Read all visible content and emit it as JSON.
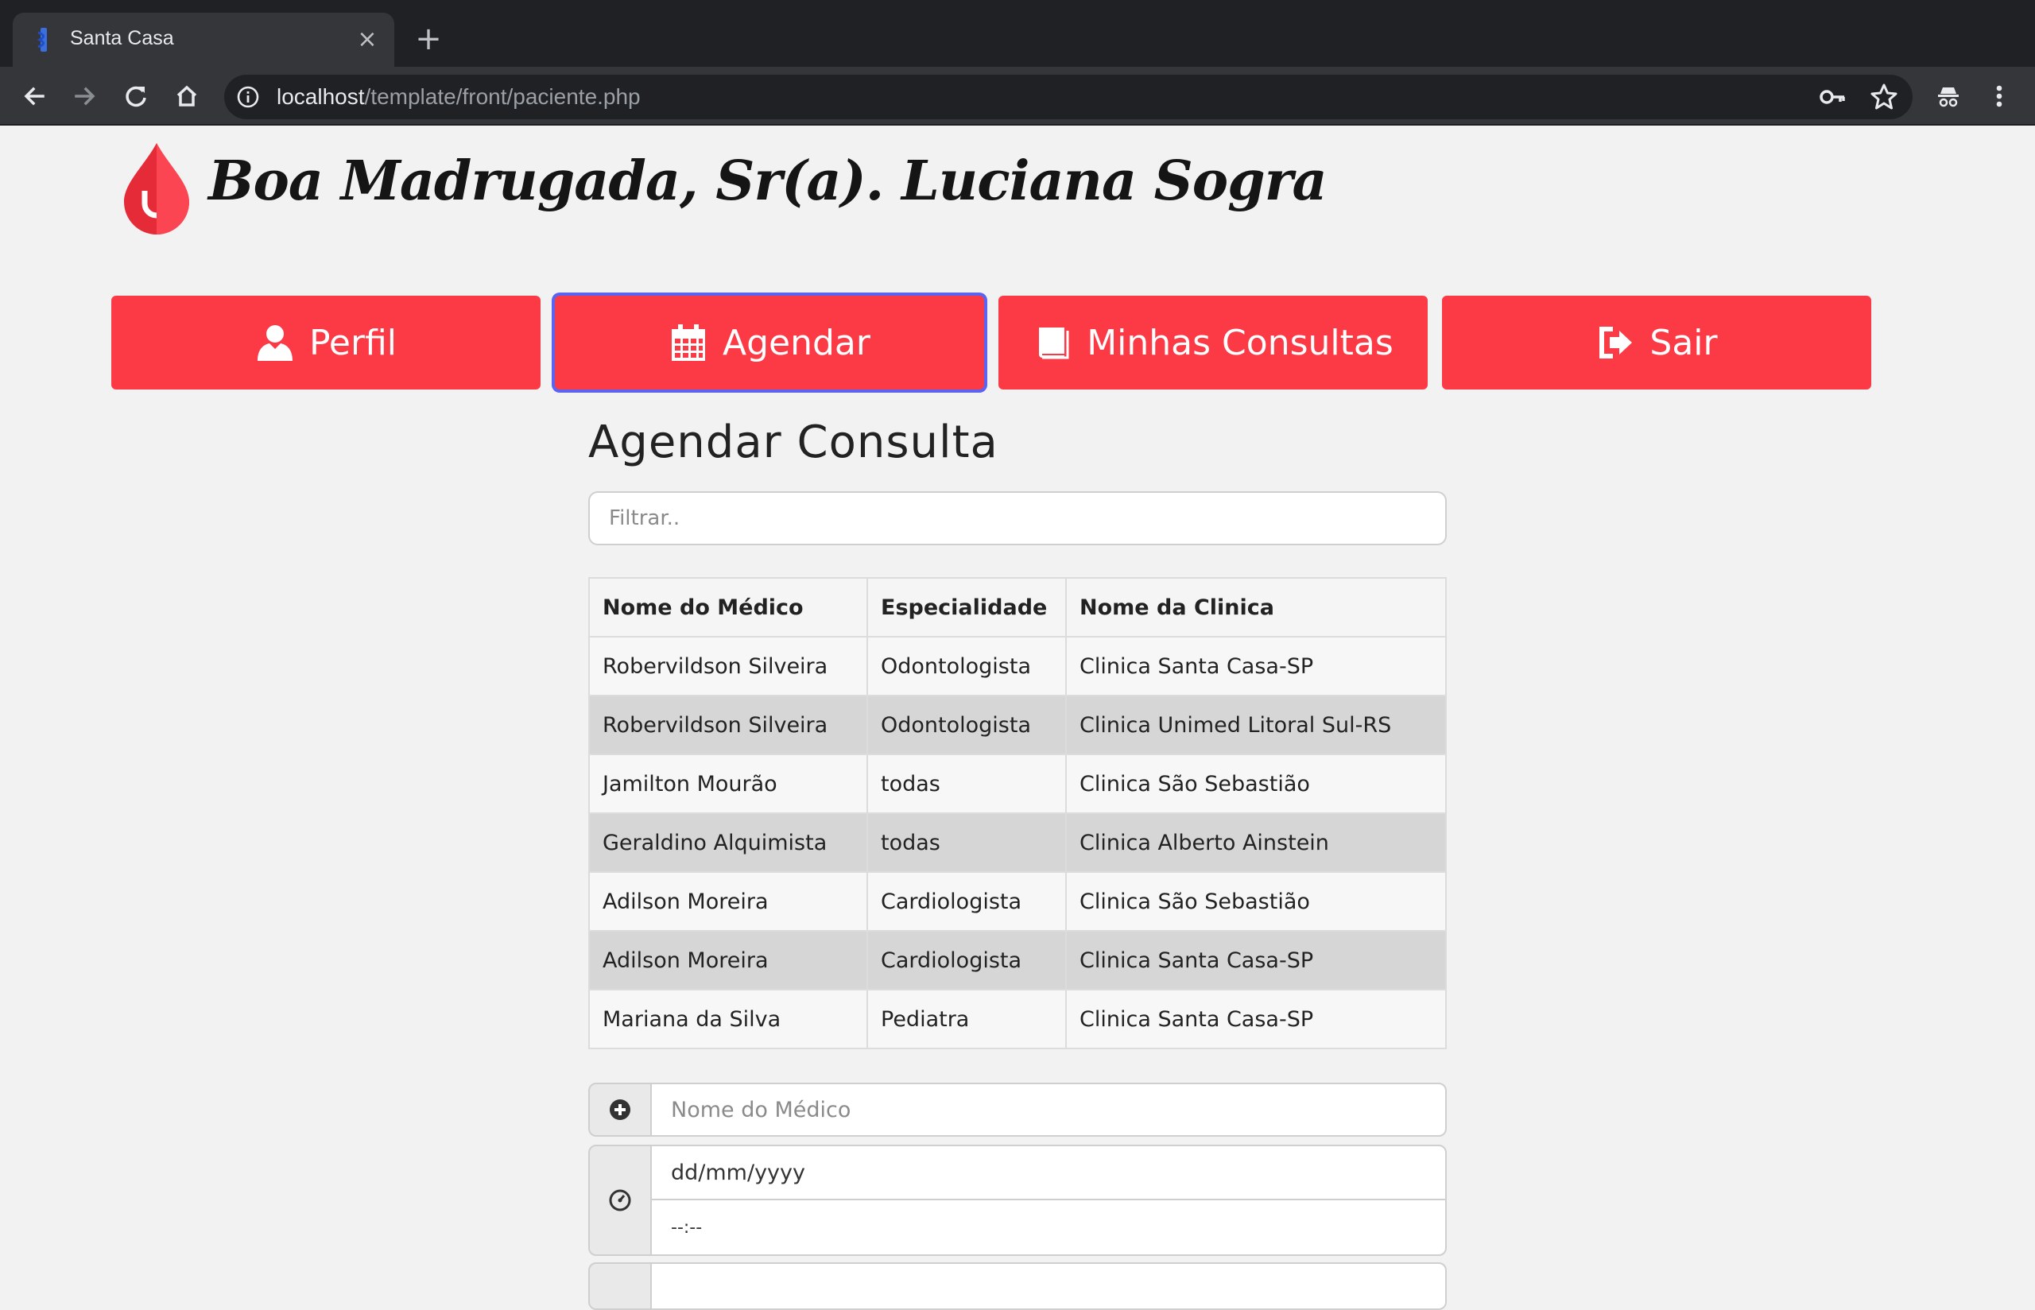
{
  "browser": {
    "tab_title": "Santa Casa",
    "tab_close": "×",
    "new_tab": "+",
    "url_host": "localhost",
    "url_path": "/template/front/paciente.php"
  },
  "header": {
    "greeting": "Boa Madrugada, Sr(a). Luciana Sogra"
  },
  "nav": {
    "perfil": "Perfil",
    "agendar": "Agendar",
    "minhas_consultas": "Minhas Consultas",
    "sair": "Sair"
  },
  "section": {
    "title": "Agendar Consulta",
    "filter_placeholder": "Filtrar.."
  },
  "table": {
    "headers": [
      "Nome do Médico",
      "Especialidade",
      "Nome da Clinica"
    ],
    "rows": [
      [
        "Robervildson Silveira",
        "Odontologista",
        "Clinica Santa Casa-SP"
      ],
      [
        "Robervildson Silveira",
        "Odontologista",
        "Clinica Unimed Litoral Sul-RS"
      ],
      [
        "Jamilton Mourão",
        "todas",
        "Clinica São Sebastião"
      ],
      [
        "Geraldino Alquimista",
        "todas",
        "Clinica Alberto Ainstein"
      ],
      [
        "Adilson Moreira",
        "Cardiologista",
        "Clinica São Sebastião"
      ],
      [
        "Adilson Moreira",
        "Cardiologista",
        "Clinica Santa Casa-SP"
      ],
      [
        "Mariana da Silva",
        "Pediatra",
        "Clinica Santa Casa-SP"
      ]
    ]
  },
  "form": {
    "medico_placeholder": "Nome do Médico",
    "date_value": "dd/mm/yyyy",
    "time_value": "--:--"
  },
  "colors": {
    "accent": "#fc3a46",
    "focus_ring": "#5b63f2",
    "chrome_dark": "#202124",
    "chrome_toolbar": "#35363a"
  }
}
